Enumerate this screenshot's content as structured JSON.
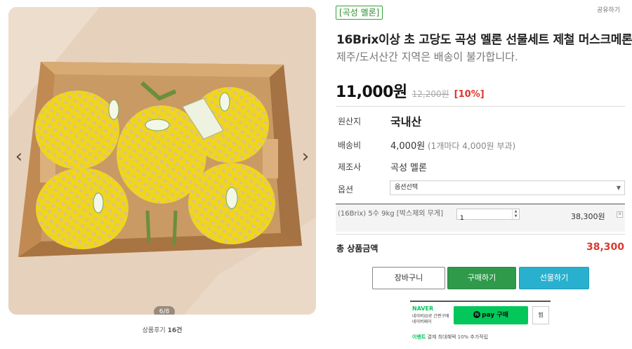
{
  "gallery": {
    "image_alt": "Gift box with five yellow melons wrapped in foam nets",
    "counter": "6/8",
    "prev_icon": "chevron-left-icon",
    "next_icon": "chevron-right-icon",
    "review_text": "상품후기 ",
    "review_count": "16건"
  },
  "header": {
    "share_label": "공유하기",
    "brand_tag": "[곡성 멜론]",
    "title": "16Brix이상 초 고당도 곡성 멜론 선물세트 제철 머스크메론",
    "subtitle": "제주/도서산간 지역은 배송이 불가합니다."
  },
  "pricing": {
    "price": "11,000원",
    "original_price": "12,200원",
    "discount": "[10%]"
  },
  "details": {
    "origin_label": "원산지",
    "origin_value": "국내산",
    "shipping_label": "배송비",
    "shipping_value": "4,000원",
    "shipping_note": " (1개마다 4,000원 부과)",
    "maker_label": "제조사",
    "maker_value": "곡성 멜론",
    "option_label": "옵션",
    "option_value": "옵션선택"
  },
  "selected_option": {
    "name": "(16Brix) 5수 9kg [박스제외 무게]",
    "quantity": "1",
    "price": "38,300원",
    "remove_icon": "close-icon"
  },
  "total": {
    "label": "총 상품금액",
    "value": "38,300"
  },
  "actions": {
    "cart_label": "장바구니",
    "buy_label": "구매하기",
    "gift_label": "선물하기"
  },
  "naver_pay": {
    "brand": "NAVER",
    "desc_line1": "네이버ID로 간편구매",
    "desc_line2": "네이버페이",
    "button_label": "pay 구매",
    "button_icon": "N",
    "wish_label": "찜",
    "event_tag": "이벤트",
    "event_text": " 결제 최대혜택 10% 추가적립"
  },
  "colors": {
    "brand_green": "#2e9a4a",
    "gift_blue": "#2ab0cf",
    "discount_red": "#e0352b",
    "naver_green": "#03c75a"
  }
}
